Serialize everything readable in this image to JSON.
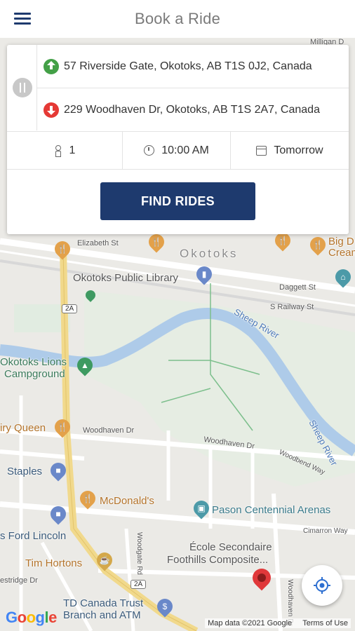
{
  "header": {
    "title": "Book a Ride",
    "menu_icon": "hamburger-menu-icon"
  },
  "booking": {
    "from_address": "57 Riverside Gate, Okotoks, AB T1S 0J2, Canada",
    "to_address": "229 Woodhaven Dr, Okotoks, AB T1S 2A7, Canada",
    "seats": "1",
    "time": "10:00 AM",
    "date": "Tomorrow",
    "find_button": "FIND RIDES",
    "colors": {
      "primary": "#1e3a6e",
      "pickup": "#43a047",
      "dropoff": "#e53935"
    }
  },
  "map": {
    "labels": {
      "milligan": "Milligan D",
      "elizabeth": "Elizabeth St",
      "okotoks": "Okotoks",
      "big_d": "Big D",
      "cream": "Cream",
      "library": "Okotoks Public Library",
      "daggett": "Daggett St",
      "railway": "S Railway St",
      "sheep_river_1": "Sheep River",
      "sheep_river_2": "Sheep River",
      "lions_1": "Okotoks Lions",
      "lions_2": "Campground",
      "dairy_queen": "iry Queen",
      "woodhaven_1": "Woodhaven Dr",
      "woodhaven_2": "Woodhaven Dr",
      "woodbend": "Woodbend Way",
      "staples": "Staples",
      "mcdonalds": "McDonald's",
      "pason": "Pason Centennial Arenas",
      "ford": "s Ford Lincoln",
      "cimarron": "Cimarron Way",
      "ecole_1": "École Secondaire",
      "ecole_2": "Foothills Composite...",
      "woodgate": "Woodgate Rd",
      "tim_hortons": "Tim Hortons",
      "westridge": "estridge Dr",
      "woodhaven_vert": "Woodhaven Dr",
      "td_1": "TD Canada Trust",
      "td_2": "Branch and ATM",
      "hwy_1": "2A",
      "hwy_2": "2A"
    },
    "google_logo": "Google",
    "map_data": "Map data ©2021 Google",
    "terms": "Terms of Use"
  }
}
